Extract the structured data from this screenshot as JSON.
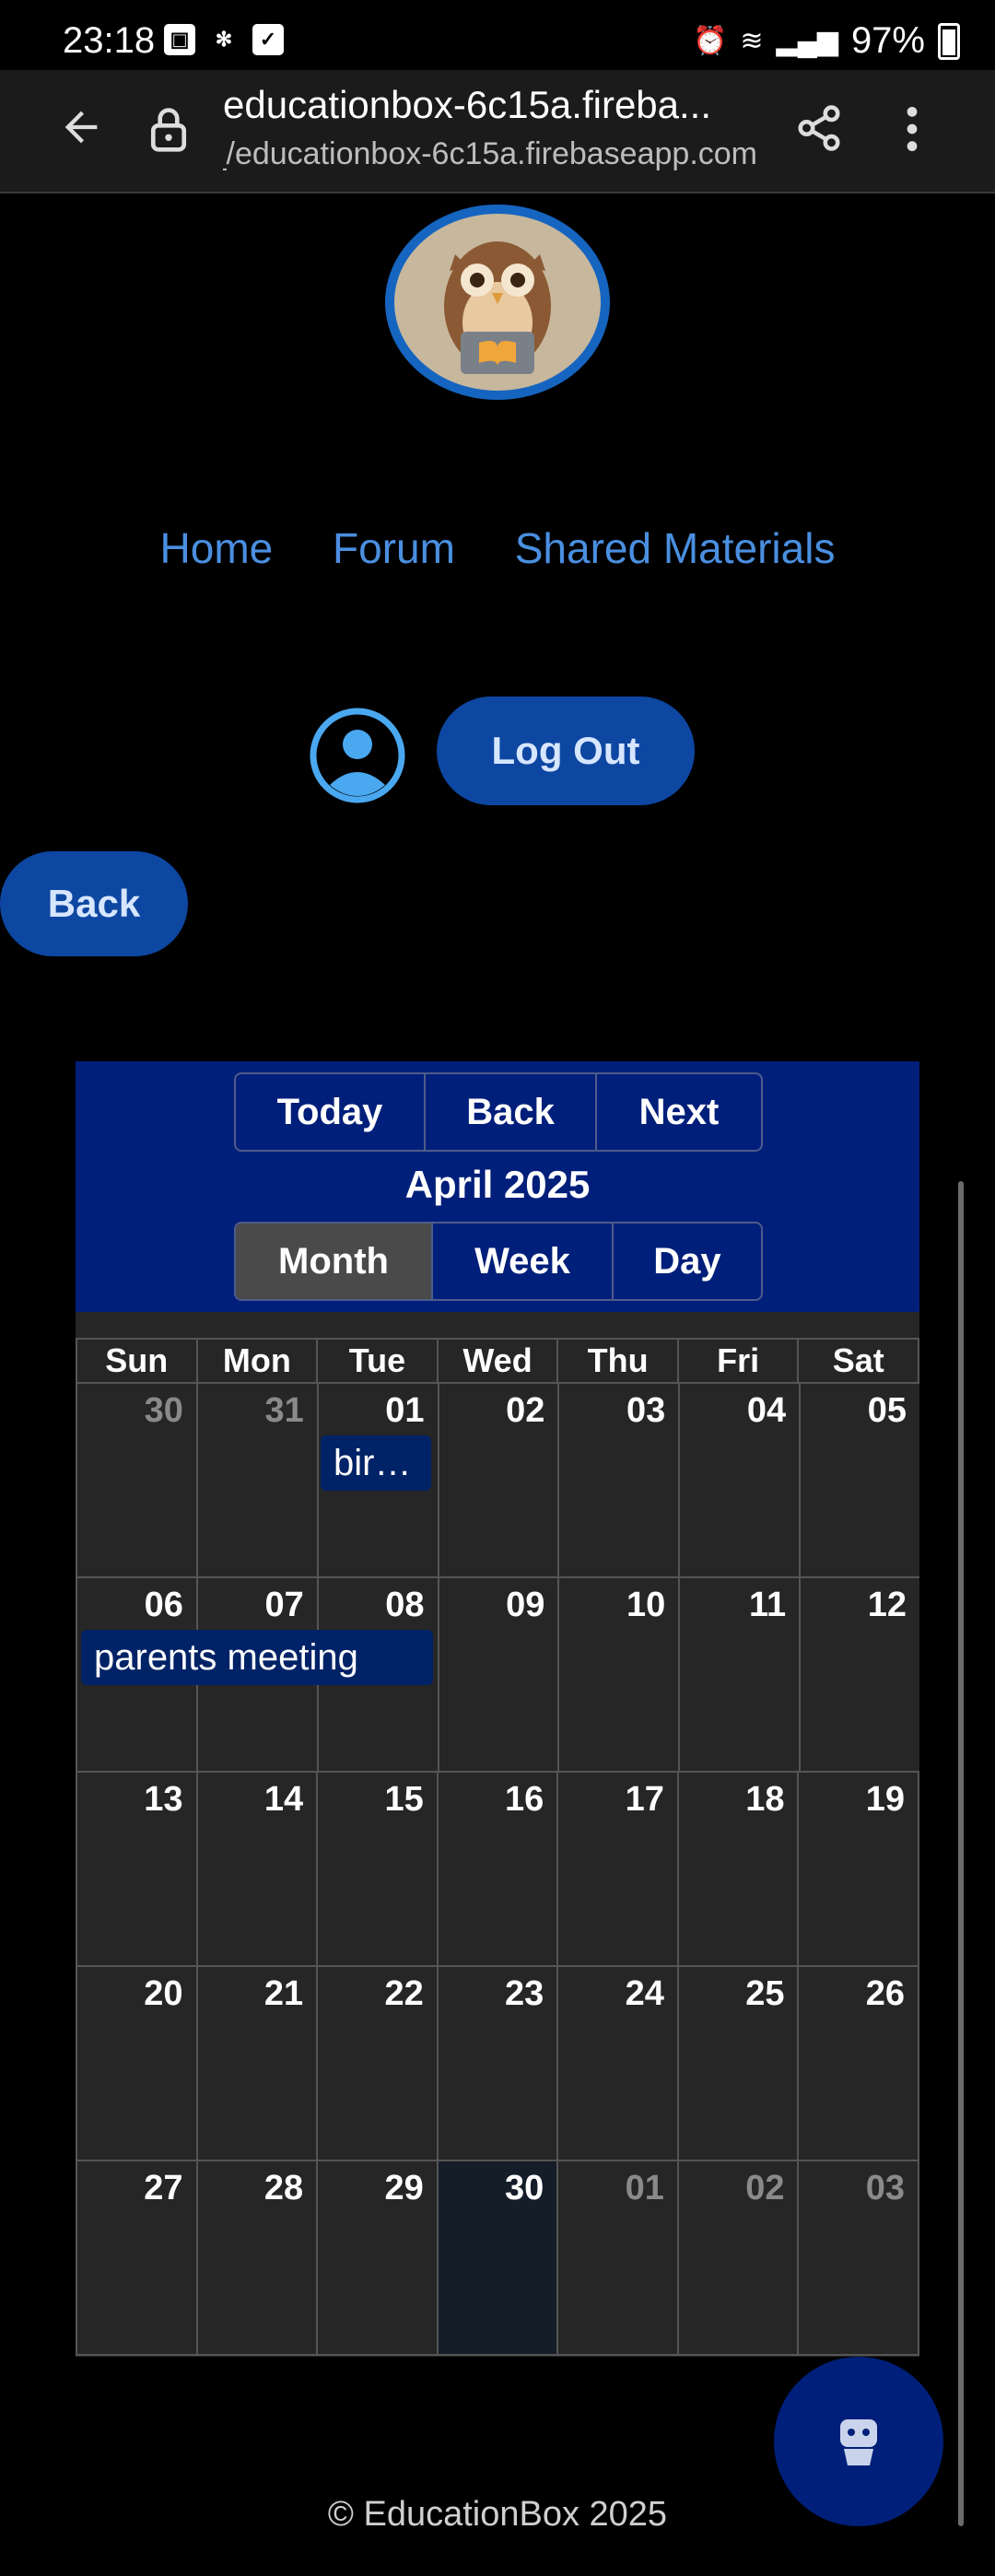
{
  "status": {
    "time": "23:18",
    "battery": "97%"
  },
  "browser": {
    "title": "educationbox-6c15a.fireba...",
    "url": "educationbox-6c15a.firebaseapp.com/_"
  },
  "nav": {
    "home": "Home",
    "forum": "Forum",
    "shared": "Shared Materials"
  },
  "account": {
    "logout": "Log Out"
  },
  "back_label": "Back",
  "calendar": {
    "nav_buttons": [
      "Today",
      "Back",
      "Next"
    ],
    "title": "April 2025",
    "views": [
      "Month",
      "Week",
      "Day"
    ],
    "active_view": "Month",
    "weekdays": [
      "Sun",
      "Mon",
      "Tue",
      "Wed",
      "Thu",
      "Fri",
      "Sat"
    ],
    "weeks": [
      [
        "30",
        "31",
        "01",
        "02",
        "03",
        "04",
        "05"
      ],
      [
        "06",
        "07",
        "08",
        "09",
        "10",
        "11",
        "12"
      ],
      [
        "13",
        "14",
        "15",
        "16",
        "17",
        "18",
        "19"
      ],
      [
        "20",
        "21",
        "22",
        "23",
        "24",
        "25",
        "26"
      ],
      [
        "27",
        "28",
        "29",
        "30",
        "01",
        "02",
        "03"
      ]
    ],
    "events": [
      {
        "label": "bir…"
      },
      {
        "label": "parents meeting"
      }
    ]
  },
  "footer": "© EducationBox 2025",
  "colors": {
    "accent": "#0d47a1",
    "link": "#4a8fe0",
    "calendar_header": "#001f7a"
  }
}
